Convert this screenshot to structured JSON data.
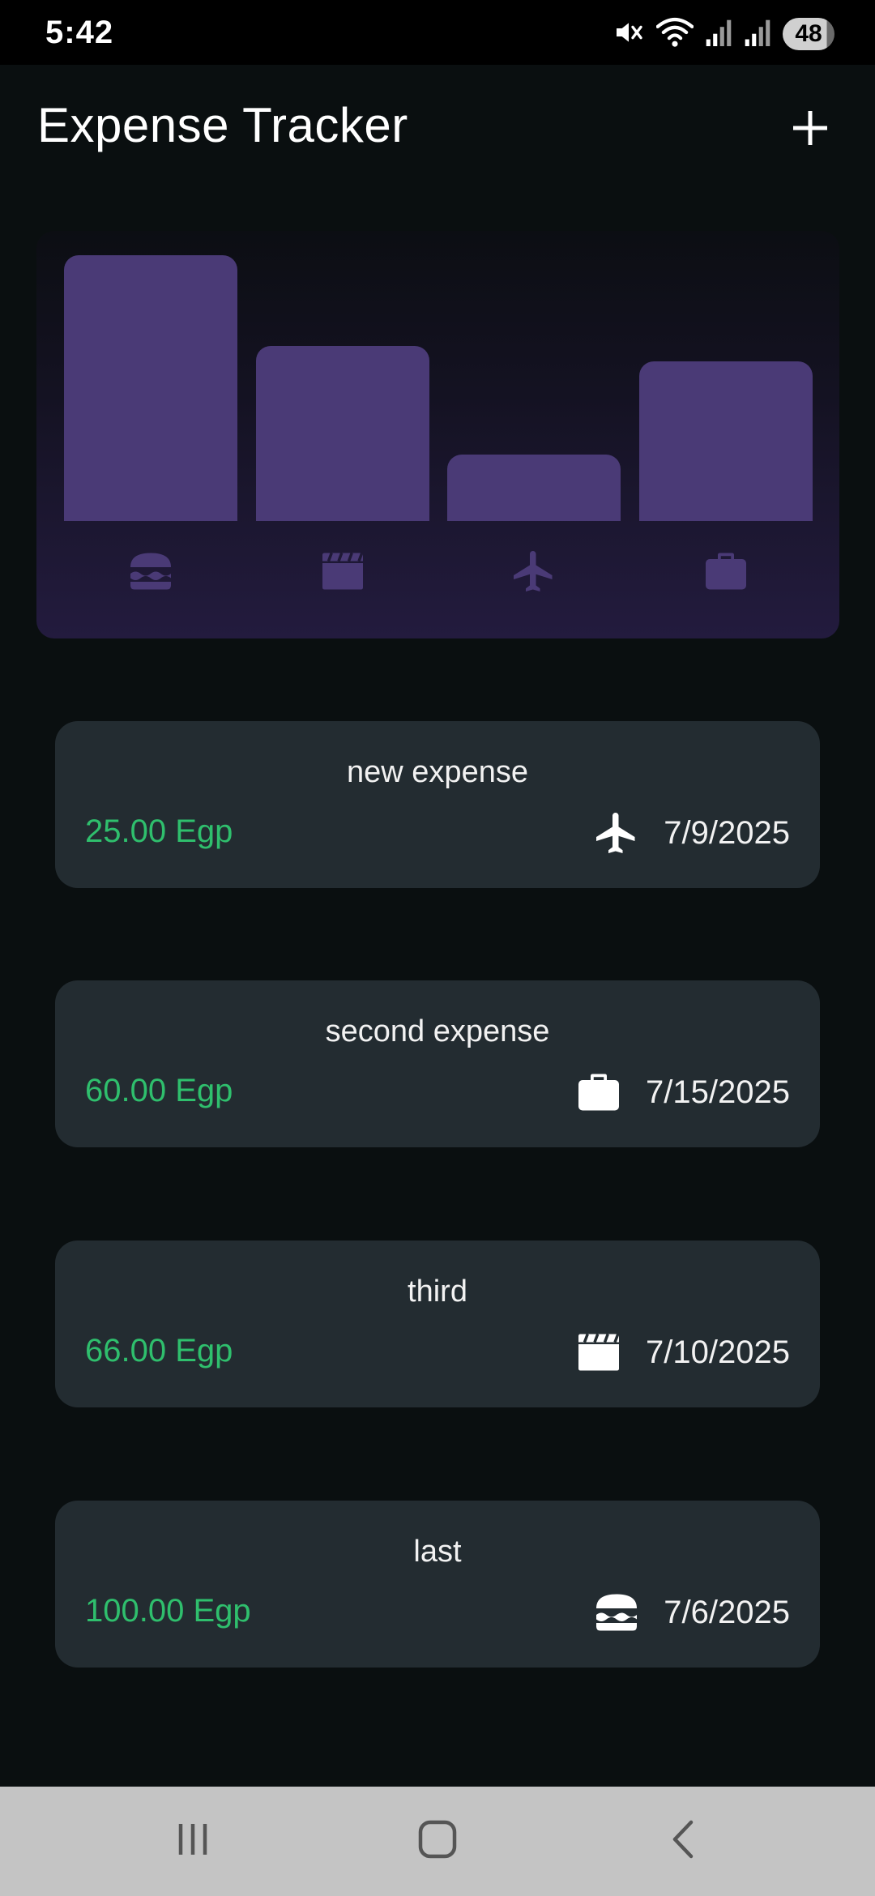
{
  "status_bar": {
    "time": "5:42",
    "battery": "48",
    "icons": [
      "mute-icon",
      "wifi-icon",
      "signal-icon",
      "signal-icon"
    ]
  },
  "app": {
    "title": "Expense Tracker",
    "add_icon": "plus-icon"
  },
  "chart_data": {
    "type": "bar",
    "categories": [
      "food",
      "leisure",
      "travel",
      "work"
    ],
    "values": [
      100,
      66,
      25,
      60
    ],
    "ylim": [
      0,
      100
    ],
    "grid": false,
    "bar_color": "#4a3a76"
  },
  "chart_icons": [
    "burger-icon",
    "clapperboard-icon",
    "airplane-icon",
    "briefcase-icon"
  ],
  "expenses": [
    {
      "title": "new expense",
      "amount": "25.00 Egp",
      "date": "7/9/2025",
      "icon": "airplane-icon"
    },
    {
      "title": "second expense",
      "amount": "60.00 Egp",
      "date": "7/15/2025",
      "icon": "briefcase-icon"
    },
    {
      "title": "third",
      "amount": "66.00 Egp",
      "date": "7/10/2025",
      "icon": "clapperboard-icon"
    },
    {
      "title": "last",
      "amount": "100.00 Egp",
      "date": "7/6/2025",
      "icon": "burger-icon"
    }
  ],
  "colors": {
    "background": "#0a0f10",
    "card": "#232c31",
    "amount": "#2fbf6d",
    "chart_bar": "#4a3a76",
    "chart_icon": "#4a3a76"
  },
  "nav_bar": [
    "recents-icon",
    "home-icon",
    "back-icon"
  ]
}
